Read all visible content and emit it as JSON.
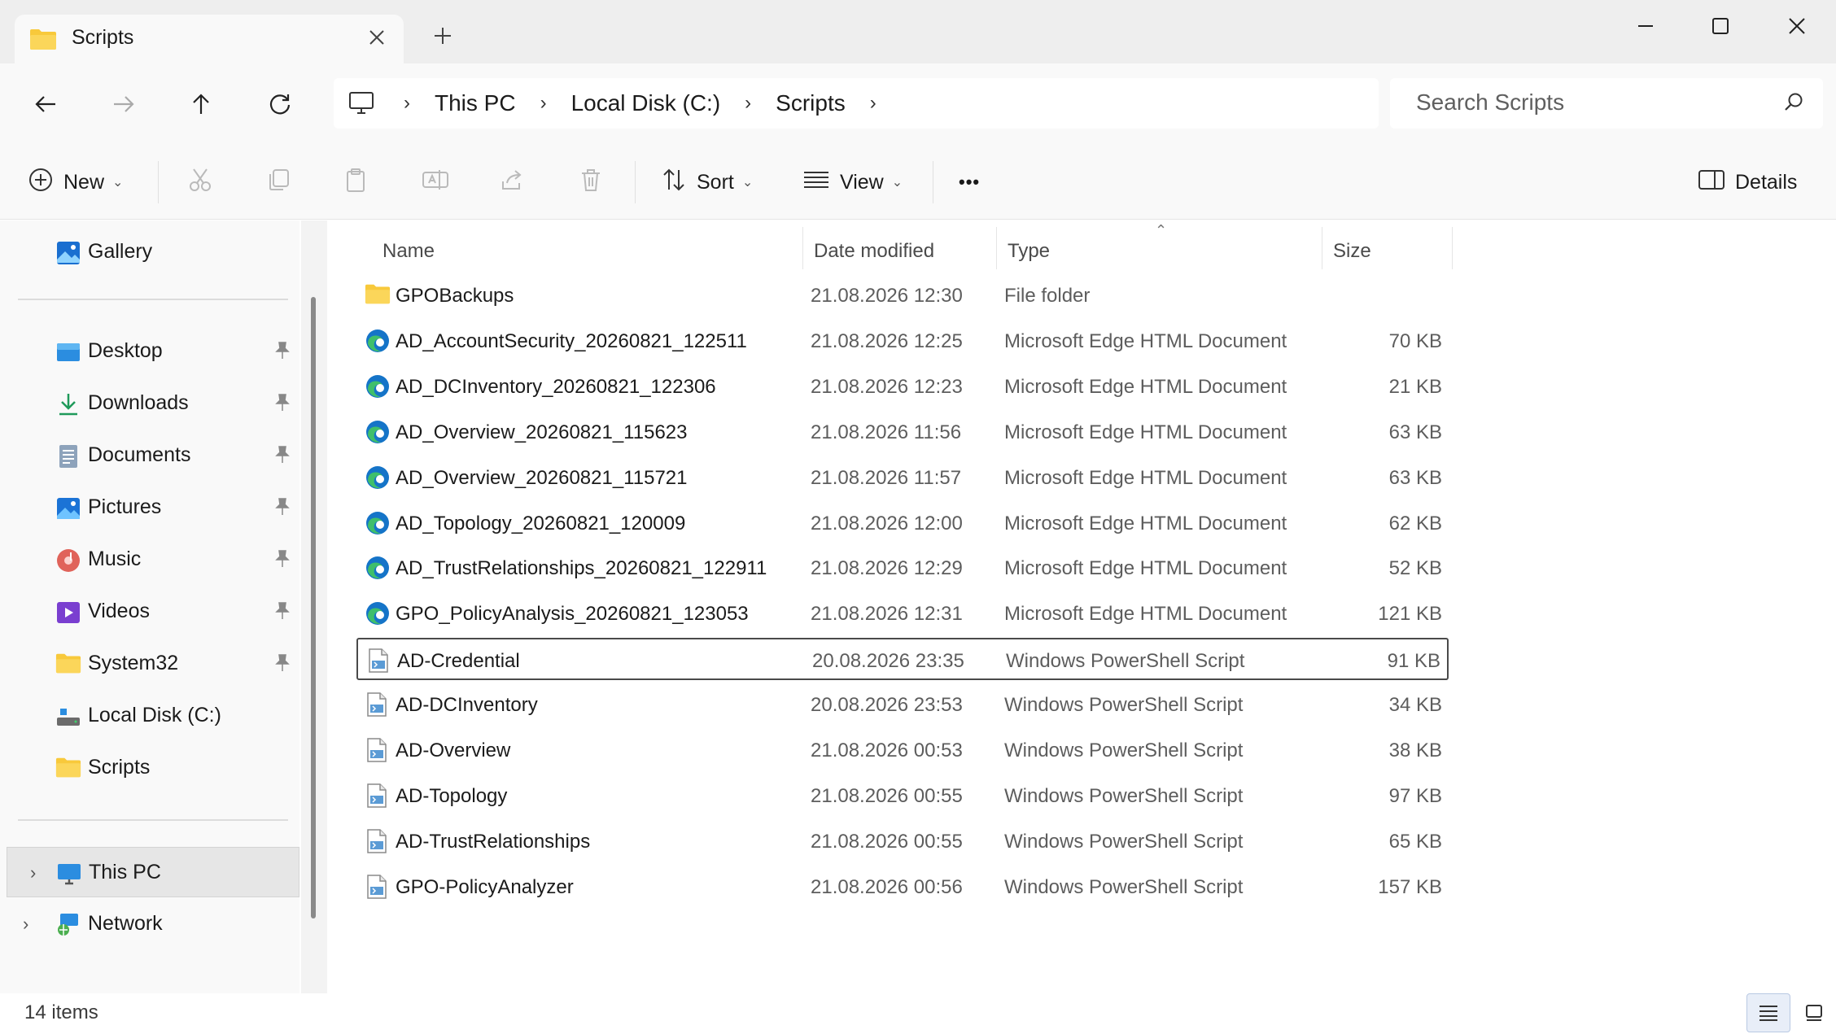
{
  "window": {
    "tab_title": "Scripts",
    "new_tab_label": "+"
  },
  "address": {
    "breadcrumbs": [
      "This PC",
      "Local Disk (C:)",
      "Scripts"
    ],
    "search_placeholder": "Search Scripts"
  },
  "commandbar": {
    "new_label": "New",
    "sort_label": "Sort",
    "view_label": "View",
    "more_label": "•••",
    "details_label": "Details"
  },
  "sidebar": {
    "gallery": "Gallery",
    "quick_access": [
      {
        "label": "Desktop",
        "icon": "desktop-icon"
      },
      {
        "label": "Downloads",
        "icon": "downloads-icon"
      },
      {
        "label": "Documents",
        "icon": "documents-icon"
      },
      {
        "label": "Pictures",
        "icon": "pictures-icon"
      },
      {
        "label": "Music",
        "icon": "music-icon"
      },
      {
        "label": "Videos",
        "icon": "videos-icon"
      },
      {
        "label": "System32",
        "icon": "folder-icon"
      }
    ],
    "local_disk": "Local Disk (C:)",
    "scripts": "Scripts",
    "this_pc": "This PC",
    "network": "Network"
  },
  "columns": {
    "name": "Name",
    "date": "Date modified",
    "type": "Type",
    "size": "Size"
  },
  "files": [
    {
      "name": "GPOBackups",
      "date": "21.08.2026 12:30",
      "type": "File folder",
      "size": "",
      "kind": "folder"
    },
    {
      "name": "AD_AccountSecurity_20260821_122511",
      "date": "21.08.2026 12:25",
      "type": "Microsoft Edge HTML Document",
      "size": "70 KB",
      "kind": "edge"
    },
    {
      "name": "AD_DCInventory_20260821_122306",
      "date": "21.08.2026 12:23",
      "type": "Microsoft Edge HTML Document",
      "size": "21 KB",
      "kind": "edge"
    },
    {
      "name": "AD_Overview_20260821_115623",
      "date": "21.08.2026 11:56",
      "type": "Microsoft Edge HTML Document",
      "size": "63 KB",
      "kind": "edge"
    },
    {
      "name": "AD_Overview_20260821_115721",
      "date": "21.08.2026 11:57",
      "type": "Microsoft Edge HTML Document",
      "size": "63 KB",
      "kind": "edge"
    },
    {
      "name": "AD_Topology_20260821_120009",
      "date": "21.08.2026 12:00",
      "type": "Microsoft Edge HTML Document",
      "size": "62 KB",
      "kind": "edge"
    },
    {
      "name": "AD_TrustRelationships_20260821_122911",
      "date": "21.08.2026 12:29",
      "type": "Microsoft Edge HTML Document",
      "size": "52 KB",
      "kind": "edge"
    },
    {
      "name": "GPO_PolicyAnalysis_20260821_123053",
      "date": "21.08.2026 12:31",
      "type": "Microsoft Edge HTML Document",
      "size": "121 KB",
      "kind": "edge"
    },
    {
      "name": "AD-Credential",
      "date": "20.08.2026 23:35",
      "type": "Windows PowerShell Script",
      "size": "91 KB",
      "kind": "ps1"
    },
    {
      "name": "AD-DCInventory",
      "date": "20.08.2026 23:53",
      "type": "Windows PowerShell Script",
      "size": "34 KB",
      "kind": "ps1"
    },
    {
      "name": "AD-Overview",
      "date": "21.08.2026 00:53",
      "type": "Windows PowerShell Script",
      "size": "38 KB",
      "kind": "ps1"
    },
    {
      "name": "AD-Topology",
      "date": "21.08.2026 00:55",
      "type": "Windows PowerShell Script",
      "size": "97 KB",
      "kind": "ps1"
    },
    {
      "name": "AD-TrustRelationships",
      "date": "21.08.2026 00:55",
      "type": "Windows PowerShell Script",
      "size": "65 KB",
      "kind": "ps1"
    },
    {
      "name": "GPO-PolicyAnalyzer",
      "date": "21.08.2026 00:56",
      "type": "Windows PowerShell Script",
      "size": "157 KB",
      "kind": "ps1"
    }
  ],
  "status": {
    "item_count": "14 items"
  },
  "colors": {
    "folder": "#f8c93b",
    "edge_blue": "#1574c8",
    "edge_green": "#3fbf6b",
    "accent": "#0067c0"
  }
}
